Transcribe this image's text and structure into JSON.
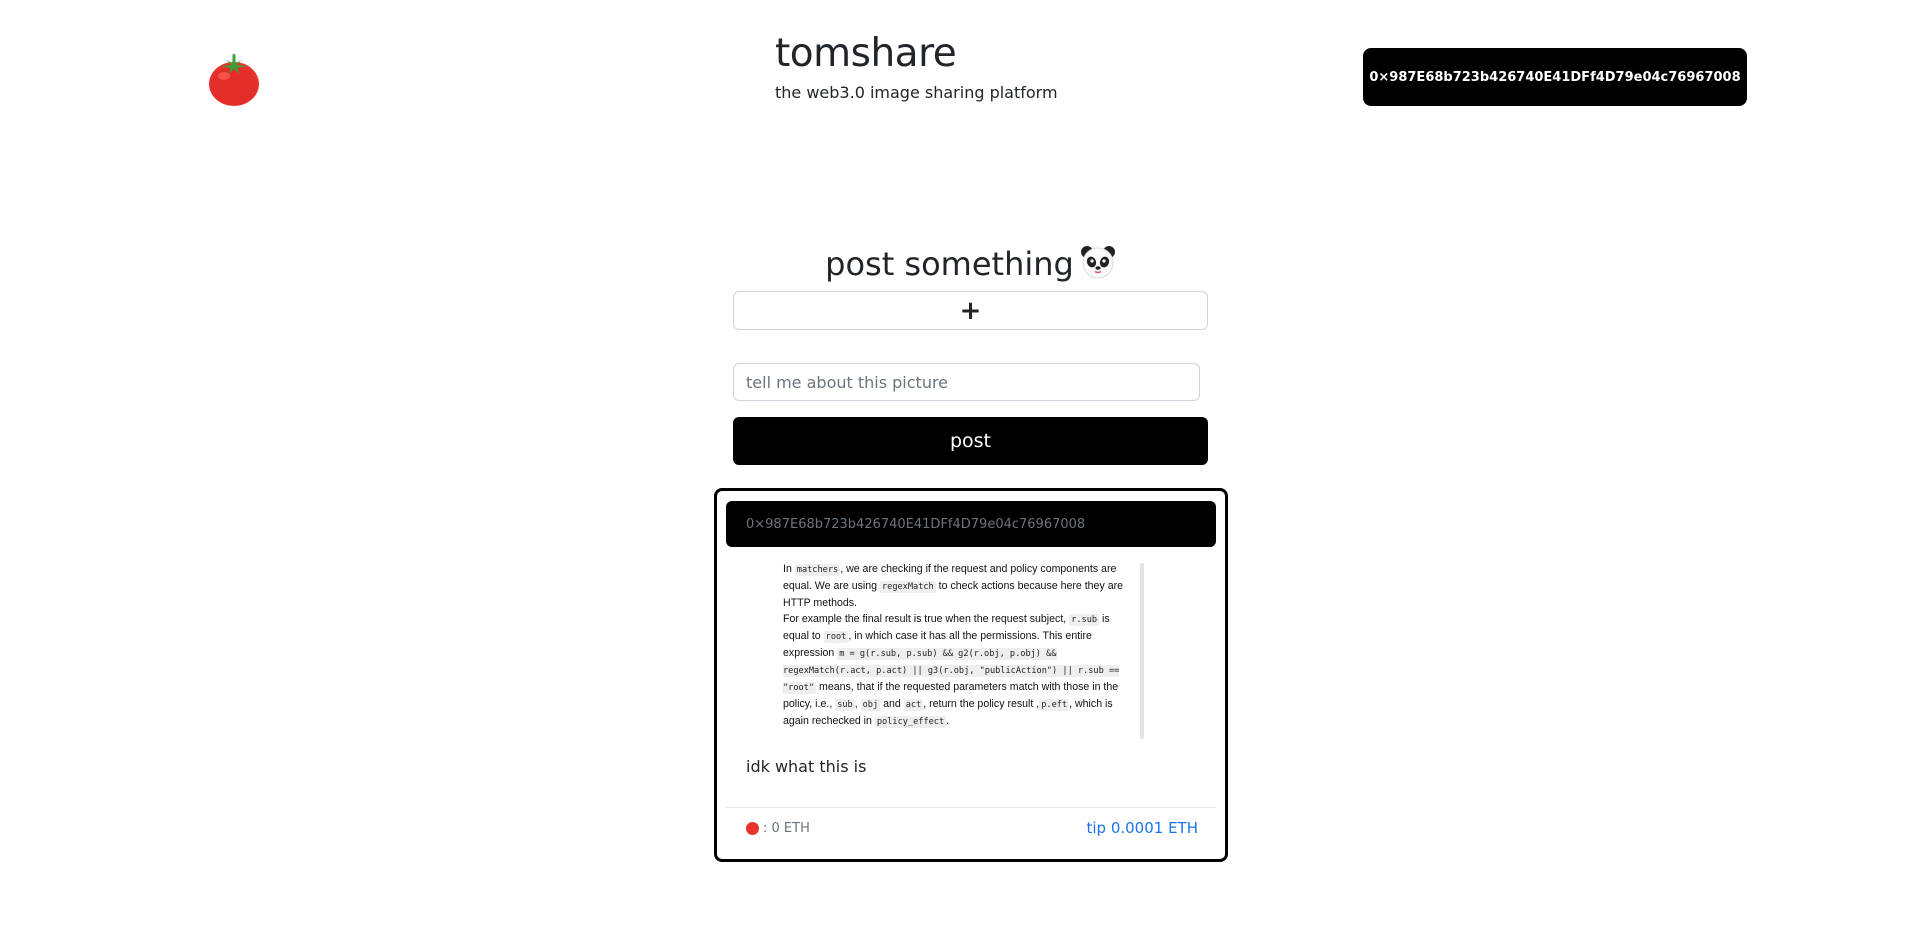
{
  "header": {
    "title": "tomshare",
    "subtitle": "the web3.0 image sharing platform",
    "wallet_address": "0×987E68b723b426740E41DFf4D79e04c76967008"
  },
  "post_form": {
    "heading": "post something",
    "file_button_label": "+",
    "caption_placeholder": "tell me about this picture",
    "caption_value": "",
    "post_button_label": "post"
  },
  "feed": [
    {
      "author_address": "0×987E68b723b426740E41DFf4D79e04c76967008",
      "caption": "idk what this is",
      "tips_total": ": 0 ETH",
      "tip_button_label": "tip 0.0001 ETH",
      "image_text": {
        "p1_a": "In ",
        "c1": "matchers",
        "p1_b": ", we are checking if the request and policy components are equal. We are using ",
        "c2": "regexMatch",
        "p1_c": " to check actions because here they are HTTP methods.",
        "p2_a": "For example the final result is true when the request subject, ",
        "c3": "r.sub",
        "p2_b": " is equal to ",
        "c4": "root",
        "p2_c": ", in which case it has all the permissions. This entire expression ",
        "c5": "m = g(r.sub, p.sub) && g2(r.obj, p.obj) && regexMatch(r.act, p.act) || g3(r.obj, \"publicAction\") || r.sub == \"root\"",
        "p2_d": " means, that if the requested parameters match with those in the policy, i.e., ",
        "c6": "sub",
        "p2_e": ", ",
        "c7": "obj",
        "p2_f": " and ",
        "c8": "act",
        "p2_g": ", return the policy result ,",
        "c9": "p.eft",
        "p2_h": ", which is again rechecked in ",
        "c10": "policy_effect",
        "p2_i": "."
      }
    }
  ],
  "colors": {
    "primary_black": "#000000",
    "link_blue": "#1a73e8",
    "muted_text": "#6c757d",
    "tomato_red": "#e8322e",
    "tomato_leaf": "#3aa335"
  },
  "icons": {
    "logo": "tomato-icon",
    "heading_emoji": "panda-icon",
    "tip_total_icon": "tomato-icon"
  }
}
